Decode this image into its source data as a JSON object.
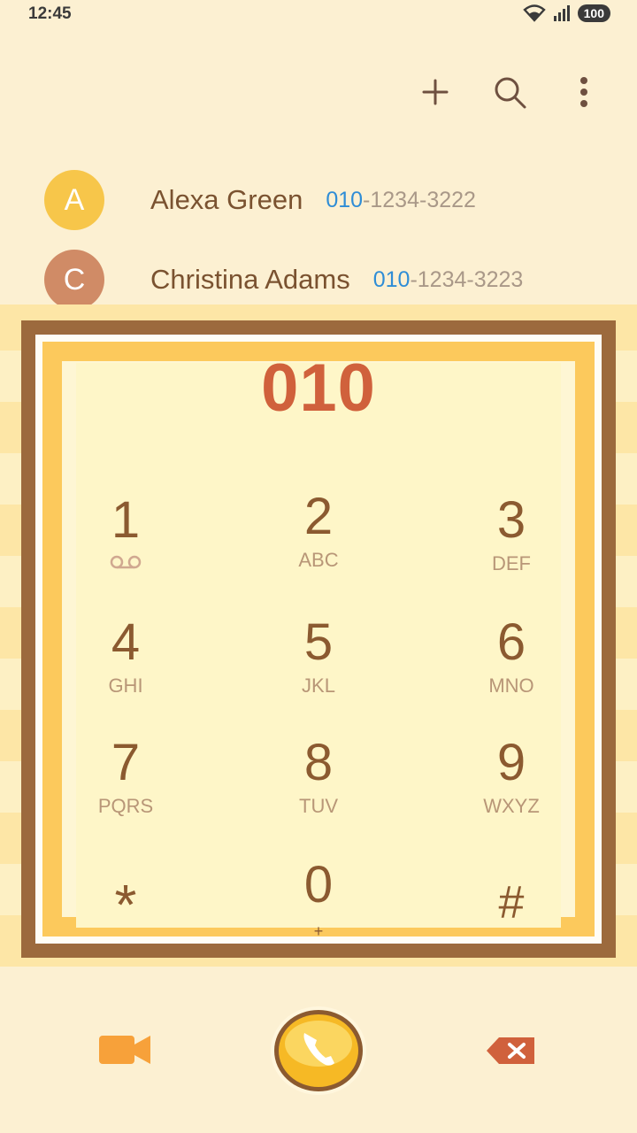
{
  "status_bar": {
    "time": "12:45",
    "battery": "100"
  },
  "contacts": [
    {
      "initial": "A",
      "name": "Alexa Green",
      "number_match": "010",
      "number_rest": "-1234-3222",
      "avatar_color": "#f7c64a"
    },
    {
      "initial": "C",
      "name": "Christina Adams",
      "number_match": "010",
      "number_rest": "-1234-3223",
      "avatar_color": "#d08b66"
    }
  ],
  "dialed_number": "010",
  "keys": [
    {
      "digit": "1",
      "letters": ""
    },
    {
      "digit": "2",
      "letters": "ABC"
    },
    {
      "digit": "3",
      "letters": "DEF"
    },
    {
      "digit": "4",
      "letters": "GHI"
    },
    {
      "digit": "5",
      "letters": "JKL"
    },
    {
      "digit": "6",
      "letters": "MNO"
    },
    {
      "digit": "7",
      "letters": "PQRS"
    },
    {
      "digit": "8",
      "letters": "TUV"
    },
    {
      "digit": "9",
      "letters": "WXYZ"
    },
    {
      "digit": "*",
      "letters": ""
    },
    {
      "digit": "0",
      "letters": "+"
    },
    {
      "digit": "#",
      "letters": ""
    }
  ],
  "colors": {
    "accent": "#d0613c",
    "brand_brown": "#8b5a30",
    "match_blue": "#2f8dd6",
    "video_orange": "#f7a13a",
    "call_gold": "#f6b925"
  },
  "icons": {
    "add": "plus-icon",
    "search": "search-icon",
    "more": "more-vert-icon",
    "voicemail": "voicemail-icon",
    "video": "video-call-icon",
    "call": "phone-icon",
    "delete": "backspace-icon"
  }
}
